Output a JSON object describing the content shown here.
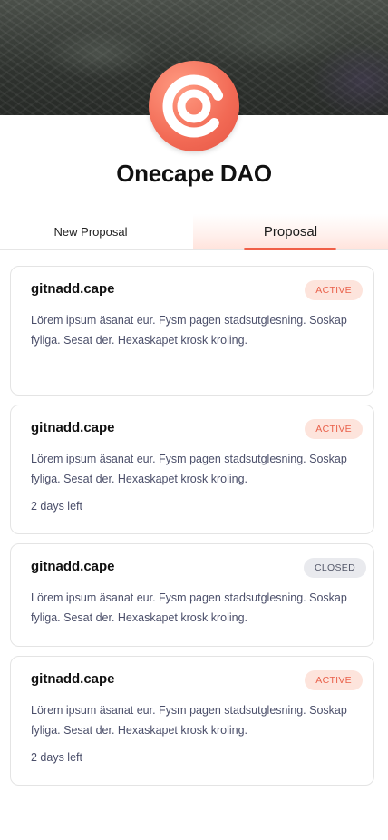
{
  "header": {
    "title": "Onecape DAO",
    "logo_icon": "onecape-logo-icon",
    "accent_color": "#f05f47"
  },
  "tabs": [
    {
      "label": "New Proposal",
      "selected": false
    },
    {
      "label": "Proposal",
      "selected": true
    }
  ],
  "proposals": [
    {
      "title": "gitnadd.cape",
      "status": "ACTIVE",
      "description": "Lörem ipsum äsanat eur. Fysm pagen stadsutglesning. Soskap fyliga. Sesat der. Hexaskapet krosk kroling.",
      "time_left": ""
    },
    {
      "title": "gitnadd.cape",
      "status": "ACTIVE",
      "description": "Lörem ipsum äsanat eur. Fysm pagen stadsutglesning. Soskap fyliga. Sesat der. Hexaskapet krosk kroling.",
      "time_left": "2 days left"
    },
    {
      "title": "gitnadd.cape",
      "status": "CLOSED",
      "description": "Lörem ipsum äsanat eur. Fysm pagen stadsutglesning. Soskap fyliga. Sesat der. Hexaskapet krosk kroling.",
      "time_left": ""
    },
    {
      "title": "gitnadd.cape",
      "status": "ACTIVE",
      "description": "Lörem ipsum äsanat eur. Fysm pagen stadsutglesning. Soskap fyliga. Sesat der. Hexaskapet krosk kroling.",
      "time_left": "2 days left"
    }
  ]
}
